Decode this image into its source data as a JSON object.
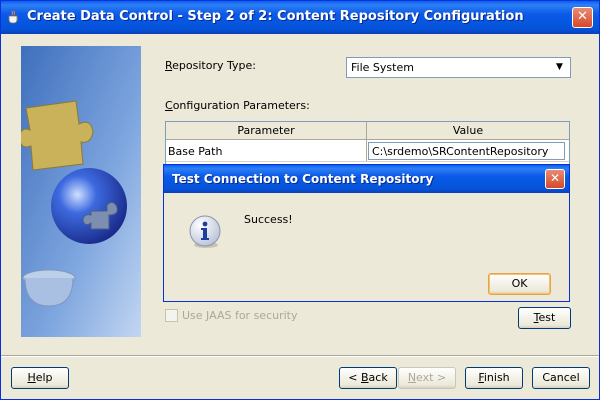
{
  "window": {
    "title": "Create Data Control - Step 2 of 2: Content Repository Configuration",
    "close_label": "✕"
  },
  "form": {
    "repository_type_label": {
      "pre": "",
      "key": "R",
      "post": "epository Type:"
    },
    "repository_type_value": "File System",
    "config_params_label": {
      "pre": "",
      "key": "C",
      "post": "onfiguration Parameters:"
    },
    "table": {
      "headers": [
        "Parameter",
        "Value"
      ],
      "rows": [
        {
          "parameter": "Base Path",
          "value": "C:\\srdemo\\SRContentRepository"
        }
      ]
    },
    "jaas_checkbox_label": {
      "pre": "Use ",
      "key": "J",
      "post": "AAS for security"
    },
    "test_button": {
      "pre": "",
      "key": "T",
      "post": "est"
    }
  },
  "footer": {
    "help": {
      "pre": "",
      "key": "H",
      "post": "elp"
    },
    "back": {
      "pre": "< ",
      "key": "B",
      "post": "ack"
    },
    "next": {
      "pre": "",
      "key": "N",
      "post": "ext >"
    },
    "finish": {
      "pre": "",
      "key": "F",
      "post": "inish"
    },
    "cancel": "Cancel"
  },
  "dialog": {
    "title": "Test Connection to Content Repository",
    "message": "Success!",
    "ok_label": "OK",
    "close_label": "✕"
  }
}
